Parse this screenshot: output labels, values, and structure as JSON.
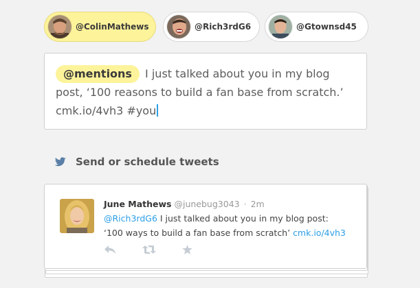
{
  "accounts": [
    {
      "handle": "@ColinMathews",
      "active": true
    },
    {
      "handle": "@Rich3rdG6",
      "active": false
    },
    {
      "handle": "@Gtownsd45",
      "active": false
    }
  ],
  "composer": {
    "mention_pill": "@mentions",
    "text_line1": "I just talked about you in my blog",
    "text_line2": "post, ‘100 reasons to build a fan base from scratch.’",
    "text_line3": "cmk.io/4vh3 #you"
  },
  "send_section": {
    "icon": "twitter-bird-icon",
    "label": "Send or schedule tweets"
  },
  "tweet": {
    "author_name": "June Mathews",
    "author_handle": "@junebug3043",
    "separator": "·",
    "time": "2m",
    "mention": "@Rich3rdG6",
    "text_part1": " I just talked about you in my blog post:",
    "text_part2": "‘100 ways to build a fan base from scratch’ ",
    "link": "cmk.io/4vh3",
    "actions": [
      "reply-icon",
      "retweet-icon",
      "favorite-icon"
    ]
  },
  "colors": {
    "highlight": "#fdf39a",
    "link": "#2b9ee6",
    "twitter_blue": "#5b7fa6",
    "background": "#f2f2f2"
  }
}
